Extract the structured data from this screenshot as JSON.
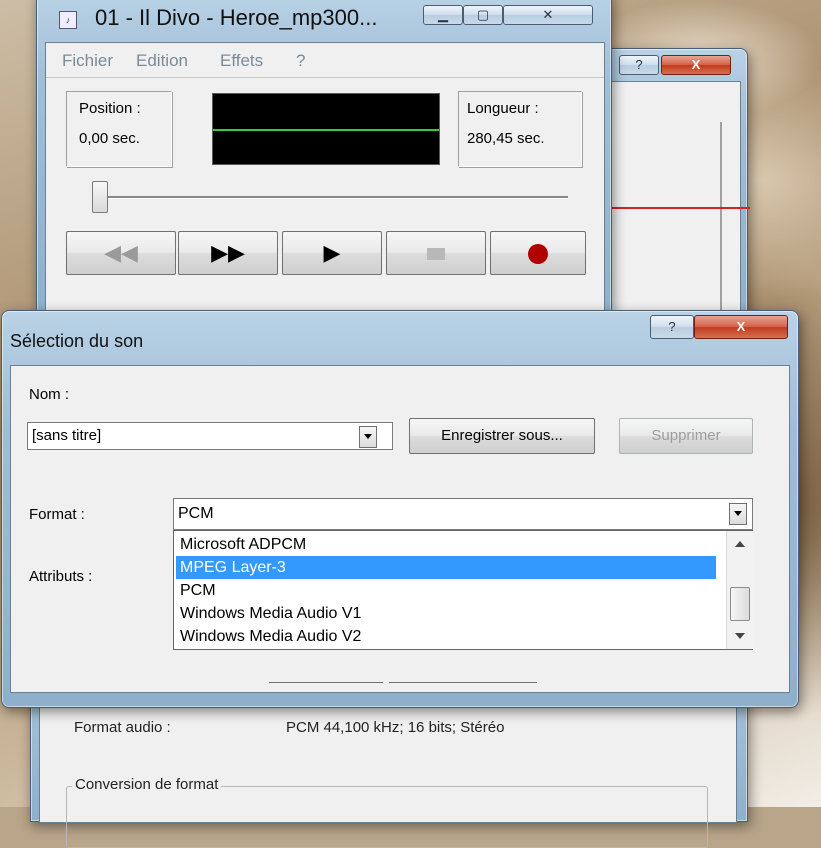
{
  "recorder": {
    "title": "01 - Il Divo - Heroe_mp300...",
    "menu": [
      "Fichier",
      "Edition",
      "Effets",
      "?"
    ],
    "position_label": "Position :",
    "position_value": "0,00 sec.",
    "length_label": "Longueur :",
    "length_value": "280,45 sec.",
    "seek_fraction": 0
  },
  "properties_window": {
    "help_label": "?",
    "close_label": "X",
    "format_audio_label": "Format audio :",
    "format_audio_value": "PCM 44,100 kHz; 16 bits; Stéréo",
    "conversion_group_label": "Conversion de format"
  },
  "dialog": {
    "title": "Sélection du son",
    "help_label": "?",
    "close_label": "X",
    "name_label": "Nom :",
    "name_value": "[sans titre]",
    "save_as_label": "Enregistrer sous...",
    "delete_label": "Supprimer",
    "format_label": "Format :",
    "format_value": "PCM",
    "attributes_label": "Attributs :",
    "format_options": [
      "Microsoft ADPCM",
      "MPEG Layer-3",
      "PCM",
      "Windows Media Audio V1",
      "Windows Media Audio V2"
    ],
    "selected_option": "MPEG Layer-3"
  },
  "colors": {
    "selection": "#3399ff",
    "waveform": "#3cc83c",
    "record": "#b00000"
  }
}
